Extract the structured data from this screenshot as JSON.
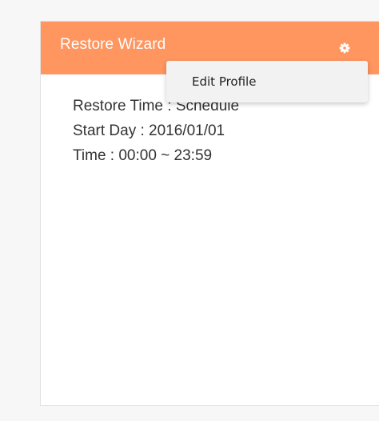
{
  "panel": {
    "title": "Restore Wizard",
    "gear_icon": "gear-icon",
    "lines": [
      "Restore Time : Schedule",
      "Start Day : 2016/01/01",
      "Time : 00:00 ~ 23:59"
    ]
  },
  "menu": {
    "items": [
      {
        "label": "Edit Profile"
      }
    ]
  },
  "colors": {
    "header": "#ff955f",
    "page_bg": "#f7f7f7",
    "menu_bg": "#f2f2f2"
  }
}
